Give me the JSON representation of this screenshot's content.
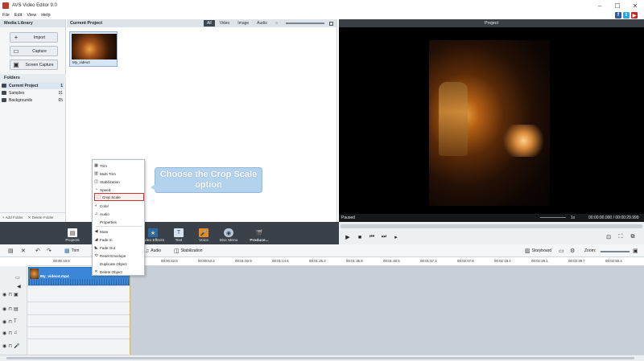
{
  "window": {
    "title": "AVS Video Editor 9.0",
    "minimize": "–",
    "maximize": "☐",
    "close": "✕"
  },
  "menu": [
    "File",
    "Edit",
    "View",
    "Help"
  ],
  "social": [
    {
      "label": "f",
      "color": "#3b5998"
    },
    {
      "label": "t",
      "color": "#2aa9e0"
    },
    {
      "label": "▶",
      "color": "#cc2020"
    }
  ],
  "media_library": {
    "title": "Media Library",
    "buttons": [
      {
        "label": "Import",
        "icon": "+"
      },
      {
        "label": "Capture",
        "icon": "▭"
      },
      {
        "label": "Screen Capture",
        "icon": "▣"
      }
    ],
    "folders_title": "Folders",
    "folders": [
      {
        "name": "Current Project",
        "count": "1"
      },
      {
        "name": "Samples",
        "count": "31"
      },
      {
        "name": "Backgrounds",
        "count": "65"
      }
    ],
    "add_folder": "+ Add Folder",
    "delete_folder": "✕ Delete Folder"
  },
  "current_project": {
    "title": "Current Project",
    "filters": [
      "All",
      "Video",
      "Image",
      "Audio"
    ],
    "active_filter": "All",
    "thumbnail_label": "My_video4"
  },
  "context_menu": {
    "items": [
      {
        "label": "Trim",
        "icon": "▦"
      },
      {
        "label": "Multi Trim",
        "icon": "▥"
      },
      {
        "label": "Stabilization",
        "icon": "◫"
      },
      {
        "label": "Speed",
        "icon": "◔"
      },
      {
        "label": "Crop Scale",
        "icon": "⬚"
      },
      {
        "label": "Color",
        "icon": "◐"
      },
      {
        "label": "Audio",
        "icon": "♫"
      },
      {
        "label": "Properties",
        "icon": " "
      },
      {
        "label": "Mute",
        "icon": "◀"
      },
      {
        "label": "Fade In",
        "icon": "◢"
      },
      {
        "label": "Fade Out",
        "icon": "◣"
      },
      {
        "label": "Reset Envelope",
        "icon": "⟲"
      },
      {
        "label": "Duplicate Object",
        "icon": " "
      },
      {
        "label": "Delete Object",
        "icon": "✕"
      }
    ],
    "highlighted": "Crop Scale"
  },
  "callout": {
    "line1": "Choose the Crop Scale",
    "line2": "option"
  },
  "preview": {
    "title": "Project",
    "status": "Paused",
    "speed": "1x",
    "time": "00:00:00.000 / 00:00:29.999"
  },
  "toolbar": [
    {
      "label": "Projects",
      "icon": "▤"
    },
    {
      "label": "Video Effects",
      "icon": "★"
    },
    {
      "label": "Text",
      "icon": "T"
    },
    {
      "label": "Voice",
      "icon": "🎤"
    },
    {
      "label": "Disc Menu",
      "icon": "◉"
    },
    {
      "label": "Produce...",
      "icon": "🎬"
    }
  ],
  "timeline_tools": {
    "trim": "Trim",
    "audio": "Audio",
    "stabilization": "Stabilization",
    "storyboard": "Storyboard",
    "zoom": "Zoom:"
  },
  "ruler": [
    "00:00:10.6",
    "00:00:42.6",
    "00:00:53.2",
    "00:01:03.9",
    "00:01:14.5",
    "00:01:25.2",
    "00:01:35.8",
    "00:01:46.5",
    "00:01:57.1",
    "00:02:07.8",
    "00:02:18.4",
    "00:02:29.1",
    "00:02:39.7",
    "00:02:50.4"
  ],
  "clip": {
    "name": "My_video4.mp4"
  }
}
